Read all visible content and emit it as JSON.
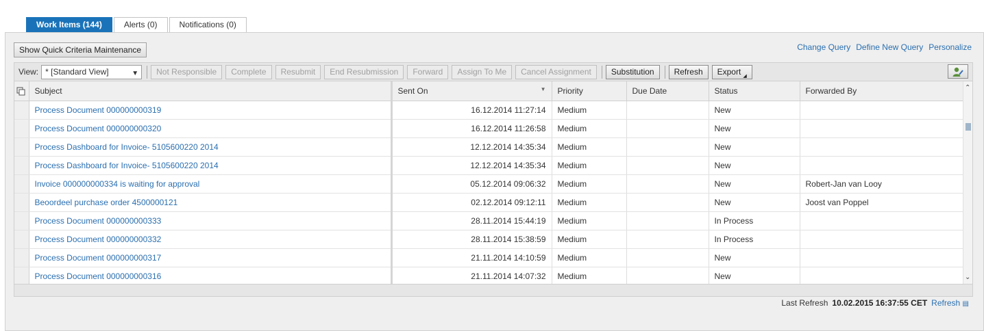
{
  "tabs": [
    {
      "label": "Work Items (144)",
      "active": true
    },
    {
      "label": "Alerts (0)",
      "active": false
    },
    {
      "label": "Notifications (0)",
      "active": false
    }
  ],
  "quick_criteria_button": "Show Quick Criteria Maintenance",
  "query_links": [
    "Change Query",
    "Define New Query",
    "Personalize"
  ],
  "toolbar": {
    "view_label": "View:",
    "view_value": "* [Standard View]",
    "disabled_buttons": [
      "Not Responsible",
      "Complete",
      "Resubmit",
      "End Resubmission",
      "Forward",
      "Assign To Me",
      "Cancel Assignment"
    ],
    "substitution": "Substitution",
    "refresh": "Refresh",
    "export": "Export"
  },
  "columns": [
    "Subject",
    "Sent On",
    "Priority",
    "Due Date",
    "Status",
    "Forwarded By"
  ],
  "rows": [
    {
      "subject": "Process Document 000000000319",
      "sent_on": "16.12.2014 11:27:14",
      "priority": "Medium",
      "due_date": "",
      "status": "New",
      "forwarded_by": ""
    },
    {
      "subject": "Process Document 000000000320",
      "sent_on": "16.12.2014 11:26:58",
      "priority": "Medium",
      "due_date": "",
      "status": "New",
      "forwarded_by": ""
    },
    {
      "subject": "Process Dashboard for Invoice- 5105600220 2014",
      "sent_on": "12.12.2014 14:35:34",
      "priority": "Medium",
      "due_date": "",
      "status": "New",
      "forwarded_by": ""
    },
    {
      "subject": "Process Dashboard for Invoice- 5105600220 2014",
      "sent_on": "12.12.2014 14:35:34",
      "priority": "Medium",
      "due_date": "",
      "status": "New",
      "forwarded_by": ""
    },
    {
      "subject": "Invoice 000000000334 is waiting for approval",
      "sent_on": "05.12.2014 09:06:32",
      "priority": "Medium",
      "due_date": "",
      "status": "New",
      "forwarded_by": "Robert-Jan van Looy"
    },
    {
      "subject": "Beoordeel purchase order 4500000121",
      "sent_on": "02.12.2014 09:12:11",
      "priority": "Medium",
      "due_date": "",
      "status": "New",
      "forwarded_by": "Joost van Poppel"
    },
    {
      "subject": "Process Document 000000000333",
      "sent_on": "28.11.2014 15:44:19",
      "priority": "Medium",
      "due_date": "",
      "status": "In Process",
      "forwarded_by": ""
    },
    {
      "subject": "Process Document 000000000332",
      "sent_on": "28.11.2014 15:38:59",
      "priority": "Medium",
      "due_date": "",
      "status": "In Process",
      "forwarded_by": ""
    },
    {
      "subject": "Process Document 000000000317",
      "sent_on": "21.11.2014 14:10:59",
      "priority": "Medium",
      "due_date": "",
      "status": "New",
      "forwarded_by": ""
    },
    {
      "subject": "Process Document 000000000316",
      "sent_on": "21.11.2014 14:07:32",
      "priority": "Medium",
      "due_date": "",
      "status": "New",
      "forwarded_by": ""
    }
  ],
  "footer": {
    "last_refresh_label": "Last Refresh",
    "last_refresh_value": "10.02.2015 16:37:55 CET",
    "refresh_link": "Refresh"
  },
  "colors": {
    "accent": "#1a73b9",
    "link": "#2a6fb0"
  },
  "icons": [
    "column-select-icon",
    "sort-descending-icon",
    "personalize-person-icon",
    "scroll-up-icon",
    "scroll-down-icon",
    "refresh-settings-icon",
    "dropdown-chevron-icon"
  ]
}
